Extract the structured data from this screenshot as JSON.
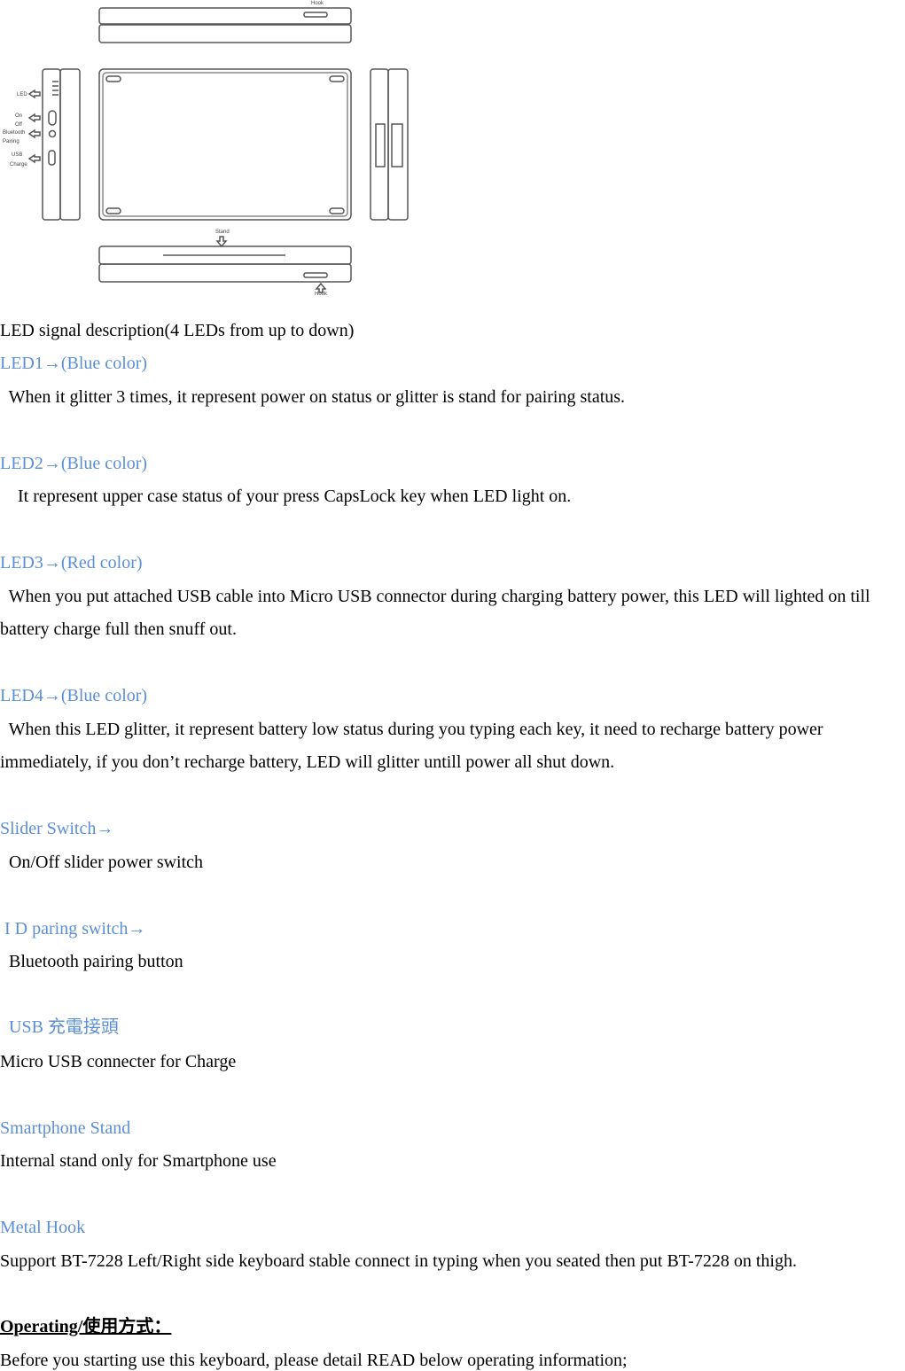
{
  "diagram": {
    "labels": {
      "hook_top": "Hook",
      "led": "LED",
      "on": "On",
      "off": "Off",
      "bluetooth": "Bluetooth",
      "pairing": "Pairing",
      "usb": "USB",
      "charge": "Charge",
      "stand": "Stand",
      "hook_bottom": "Hook"
    }
  },
  "accent_color": "#5b8fd6",
  "intro": "LED signal description(4 LEDs from up to down)",
  "sections": [
    {
      "heading": "LED1→(Blue color)",
      "lines": [
        "  When it glitter 3 times, it represent power on status or glitter is stand for pairing status."
      ]
    },
    {
      "heading": "LED2→(Blue color)",
      "lines": [
        "    It represent upper case status of your press CapsLock key when LED light on."
      ]
    },
    {
      "heading": "LED3→(Red color)",
      "lines": [
        "  When you put attached USB cable into Micro USB connector during charging battery power, this LED will lighted on till",
        "battery charge full then snuff out."
      ]
    },
    {
      "heading": "LED4→(Blue color)",
      "lines": [
        "  When this LED glitter, it represent battery low status during you typing each key, it need to recharge battery power",
        "immediately, if you don’t recharge battery, LED will glitter untill power all shut down."
      ]
    },
    {
      "heading": "Slider Switch→",
      "lines": [
        "  On/Off slider power switch"
      ]
    },
    {
      "heading": " I D paring switch→",
      "lines": [
        "  Bluetooth pairing button"
      ]
    },
    {
      "heading": "  USB 充電接頭",
      "lines": [
        "Micro USB connecter for Charge"
      ]
    },
    {
      "heading": "Smartphone Stand",
      "lines": [
        "Internal stand only for Smartphone use"
      ]
    },
    {
      "heading": "Metal Hook",
      "lines": [
        "Support BT-7228 Left/Right side keyboard stable connect in typing when you seated then put BT-7228 on thigh."
      ]
    }
  ],
  "operating": {
    "heading": "Operating/使用方式：",
    "text": "Before you starting use this keyboard, please detail READ below operating information;"
  }
}
